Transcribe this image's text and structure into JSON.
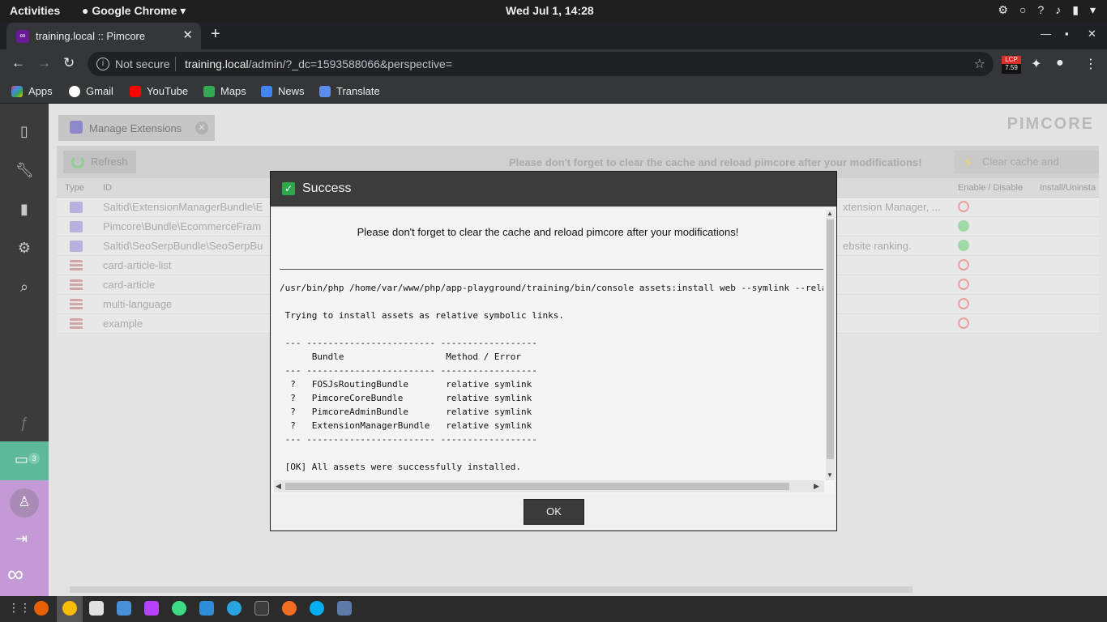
{
  "gnome": {
    "activities": "Activities",
    "app": "Google Chrome",
    "clock": "Wed Jul  1, 14:28"
  },
  "chrome": {
    "tab_title": "training.local :: Pimcore",
    "not_secure": "Not secure",
    "url_host": "training.local",
    "url_path": "/admin/?_dc=1593588066&perspective=",
    "lcp_label": "LCP",
    "lcp_value": "7.59",
    "bookmarks": [
      "Apps",
      "Gmail",
      "YouTube",
      "Maps",
      "News",
      "Translate"
    ]
  },
  "pimcore": {
    "tab_label": "Manage Extensions",
    "logo": "PIMCORE",
    "refresh_label": "Refresh",
    "warning": "Please don't forget to clear the cache and reload pimcore after your modifications!",
    "clear_cache_label": "Clear cache and reload",
    "notification_count": "3",
    "columns": [
      "Type",
      "ID",
      "Enable / Disable",
      "Install/Uninsta"
    ],
    "rows": [
      {
        "id": "Saltid\\ExtensionManagerBundle\\E",
        "desc": "xtension Manager, ...",
        "status": "disabled",
        "icon": "bundle"
      },
      {
        "id": "Pimcore\\Bundle\\EcommerceFram",
        "desc": "",
        "status": "enabled",
        "icon": "bundle"
      },
      {
        "id": "Saltid\\SeoSerpBundle\\SeoSerpBu",
        "desc": "ebsite ranking.",
        "status": "enabled",
        "icon": "bundle"
      },
      {
        "id": "card-article-list",
        "desc": "",
        "status": "disabled",
        "icon": "brick"
      },
      {
        "id": "card-article",
        "desc": "",
        "status": "disabled",
        "icon": "brick"
      },
      {
        "id": "multi-language",
        "desc": "",
        "status": "disabled",
        "icon": "brick"
      },
      {
        "id": "example",
        "desc": "",
        "status": "disabled",
        "icon": "brick"
      }
    ]
  },
  "modal": {
    "title": "Success",
    "message": "Please don't forget to clear the cache and reload pimcore after your modifications!",
    "console_lines": [
      "/usr/bin/php /home/var/www/php/app-playground/training/bin/console assets:install web --symlink --rela",
      "",
      " Trying to install assets as relative symbolic links.",
      "",
      " --- ------------------------ ------------------",
      "      Bundle                   Method / Error",
      " --- ------------------------ ------------------",
      "  ?   FOSJsRoutingBundle       relative symlink",
      "  ?   PimcoreCoreBundle        relative symlink",
      "  ?   PimcoreAdminBundle       relative symlink",
      "  ?   ExtensionManagerBundle   relative symlink",
      " --- ------------------------ ------------------",
      "",
      " [OK] All assets were successfully installed."
    ],
    "ok_label": "OK"
  }
}
